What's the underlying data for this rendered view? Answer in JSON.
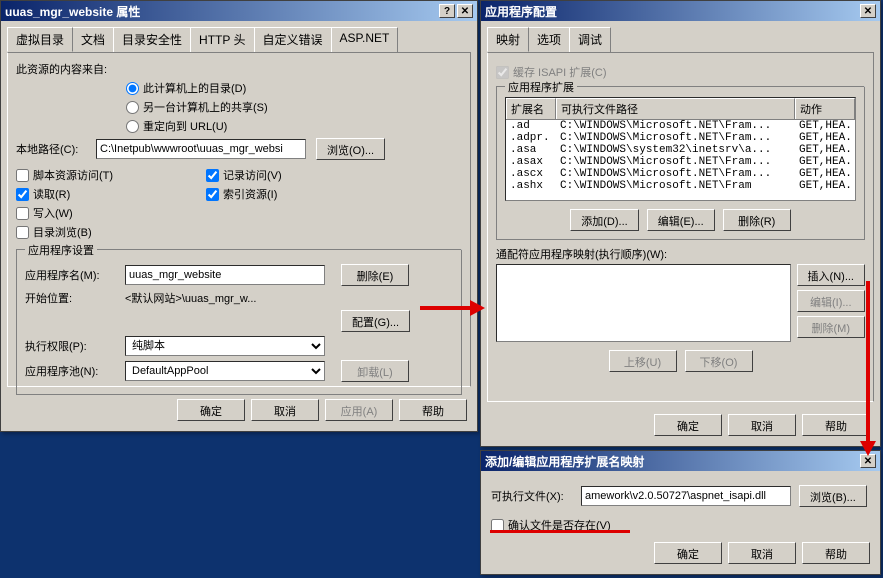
{
  "dlg1": {
    "title": "uuas_mgr_website 属性",
    "tabs": [
      "虚拟目录",
      "文档",
      "目录安全性",
      "HTTP 头",
      "自定义错误",
      "ASP.NET"
    ],
    "content_label": "此资源的内容来自:",
    "radio1": "此计算机上的目录(D)",
    "radio2": "另一台计算机上的共享(S)",
    "radio3": "重定向到 URL(U)",
    "path_label": "本地路径(C):",
    "path_value": "C:\\Inetpub\\wwwroot\\uuas_mgr_websi",
    "browse": "浏览(O)...",
    "chk_script": "脚本资源访问(T)",
    "chk_read": "读取(R)",
    "chk_write": "写入(W)",
    "chk_dirbrowse": "目录浏览(B)",
    "chk_log": "记录访问(V)",
    "chk_index": "索引资源(I)",
    "appset_legend": "应用程序设置",
    "appname_label": "应用程序名(M):",
    "appname_value": "uuas_mgr_website",
    "remove": "删除(E)",
    "startloc_label": "开始位置:",
    "startloc_value": "<默认网站>\\uuas_mgr_w...",
    "config": "配置(G)...",
    "exec_label": "执行权限(P):",
    "exec_value": "纯脚本",
    "apppool_label": "应用程序池(N):",
    "apppool_value": "DefaultAppPool",
    "unload": "卸载(L)",
    "ok": "确定",
    "cancel": "取消",
    "apply": "应用(A)",
    "help": "帮助"
  },
  "dlg2": {
    "title": "应用程序配置",
    "tabs": [
      "映射",
      "选项",
      "调试"
    ],
    "cache_label": "缓存 ISAPI 扩展(C)",
    "ext_legend": "应用程序扩展",
    "col_ext": "扩展名",
    "col_path": "可执行文件路径",
    "col_action": "动作",
    "rows": [
      {
        "ext": ".ad",
        "path": "C:\\WINDOWS\\Microsoft.NET\\Fram...",
        "act": "GET,HEA."
      },
      {
        "ext": ".adpr.",
        "path": "C:\\WINDOWS\\Microsoft.NET\\Fram...",
        "act": "GET,HEA."
      },
      {
        "ext": ".asa",
        "path": "C:\\WINDOWS\\system32\\inetsrv\\a...",
        "act": "GET,HEA."
      },
      {
        "ext": ".asax",
        "path": "C:\\WINDOWS\\Microsoft.NET\\Fram...",
        "act": "GET,HEA."
      },
      {
        "ext": ".ascx",
        "path": "C:\\WINDOWS\\Microsoft.NET\\Fram...",
        "act": "GET,HEA."
      },
      {
        "ext": ".ashx",
        "path": "C:\\WINDOWS\\Microsoft.NET\\Fram",
        "act": "GET,HEA."
      }
    ],
    "add": "添加(D)...",
    "edit": "编辑(E)...",
    "del": "删除(R)",
    "wild_legend": "通配符应用程序映射(执行顺序)(W):",
    "insert": "插入(N)...",
    "edit2": "编辑(I)...",
    "del2": "删除(M)",
    "up": "上移(U)",
    "down": "下移(O)",
    "ok": "确定",
    "cancel": "取消",
    "help": "帮助"
  },
  "dlg3": {
    "title": "添加/编辑应用程序扩展名映射",
    "exec_label": "可执行文件(X):",
    "exec_value": "amework\\v2.0.50727\\aspnet_isapi.dll",
    "browse": "浏览(B)...",
    "check_label": "确认文件是否存在(V)",
    "ok": "确定",
    "cancel": "取消",
    "help": "帮助"
  }
}
